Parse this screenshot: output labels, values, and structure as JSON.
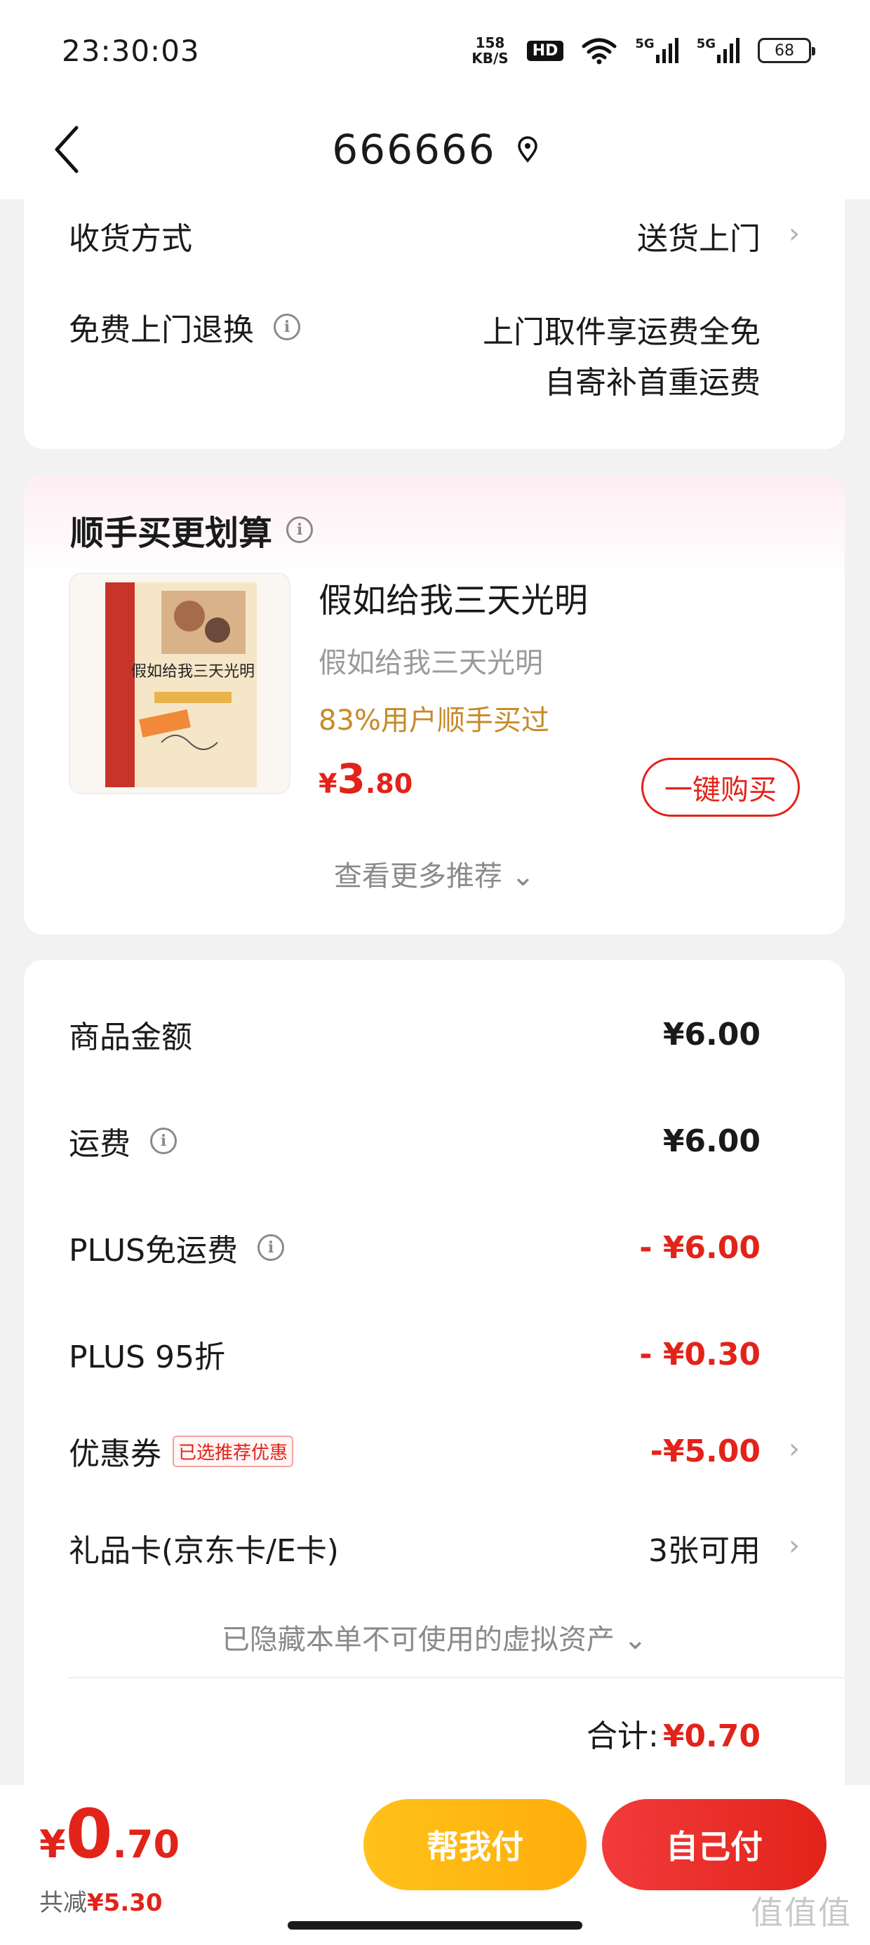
{
  "status_bar": {
    "time": "23:30:03",
    "net_speed_value": "158",
    "net_speed_unit": "KB/S",
    "hd_label": "HD",
    "signal1_label": "5G",
    "signal2_label": "5G",
    "battery": "68"
  },
  "nav": {
    "title": "666666",
    "back_icon": "chevron-left-icon",
    "location_icon": "location-pin-icon"
  },
  "delivery": {
    "method_label": "收货方式",
    "method_value": "送货上门",
    "return_label": "免费上门退换",
    "return_line1": "上门取件享运费全免",
    "return_line2": "自寄补首重运费"
  },
  "recommend": {
    "title": "顺手买更划算",
    "product_name": "假如给我三天光明",
    "product_sub": "假如给我三天光明",
    "hint": "83%用户顺手买过",
    "price_currency": "¥",
    "price_int": "3",
    "price_dec": ".80",
    "buy_label": "一键购买",
    "see_more": "查看更多推荐",
    "book_cover_title": "假如给我三天光明"
  },
  "summary": {
    "goods_label": "商品金额",
    "goods_value": "¥6.00",
    "freight_label": "运费",
    "freight_value": "¥6.00",
    "plus_free_label": "PLUS免运费",
    "plus_free_value": "- ¥6.00",
    "plus_discount_label": "PLUS 95折",
    "plus_discount_value": "- ¥0.30",
    "coupon_label": "优惠券",
    "coupon_badge": "已选推荐优惠",
    "coupon_value": "-¥5.00",
    "giftcard_label": "礼品卡(京东卡/E卡)",
    "giftcard_value": "3张可用",
    "hidden_assets": "已隐藏本单不可使用的虚拟资产",
    "total_label": "合计:",
    "total_value": "¥0.70"
  },
  "bottom": {
    "price_currency": "¥",
    "price_int": "0",
    "price_dec": ".70",
    "saved_label": "共减",
    "saved_value": "¥5.30",
    "help_pay_label": "帮我付",
    "self_pay_label": "自己付"
  },
  "watermark": "值值值",
  "colors": {
    "accent_red": "#e2231a",
    "hint_gold": "#c68a28",
    "help_pay_yellow": "#ffc21a"
  }
}
